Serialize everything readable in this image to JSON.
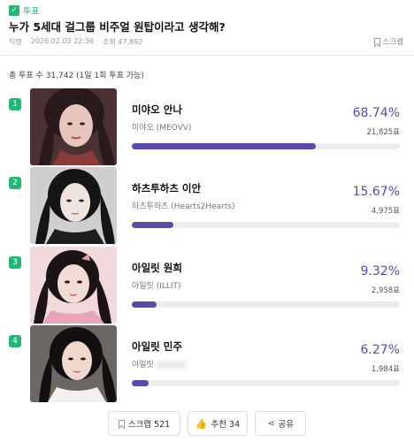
{
  "post": {
    "tag": "투표",
    "title": "누가 5세대 걸그룹 비주얼 원탑이라고 생각해?",
    "author": "익명",
    "date": "2026.02.03 22:36",
    "views_label": "조회 47,892",
    "scrap_label": "스크랩"
  },
  "poll": {
    "total_label": "총 투표 수  31,742 (1일 1회 투표 가능)",
    "options": [
      {
        "num": "1",
        "name": "미야오 안나",
        "sub": "미야오 (MEOVV)",
        "pct": "68.74%",
        "votes": "21,825표",
        "percent": 68.74
      },
      {
        "num": "2",
        "name": "하츠투하츠 이안",
        "sub": "하츠투하츠 (Hearts2Hearts)",
        "pct": "15.67%",
        "votes": "4,975표",
        "percent": 15.67
      },
      {
        "num": "3",
        "name": "아일릿 원희",
        "sub": "아일릿 (ILLIT)",
        "pct": "9.32%",
        "votes": "2,958표",
        "percent": 9.32
      },
      {
        "num": "4",
        "name": "아일릿 민주",
        "sub": "아일릿",
        "pct": "6.27%",
        "votes": "1,984표",
        "percent": 6.27
      }
    ]
  },
  "actions": {
    "scrap": "스크랩 521",
    "like": "추천 34",
    "share": "공유"
  },
  "colors": {
    "accent": "#22b573",
    "bar": "#5b4aa8",
    "track": "#ececec"
  }
}
